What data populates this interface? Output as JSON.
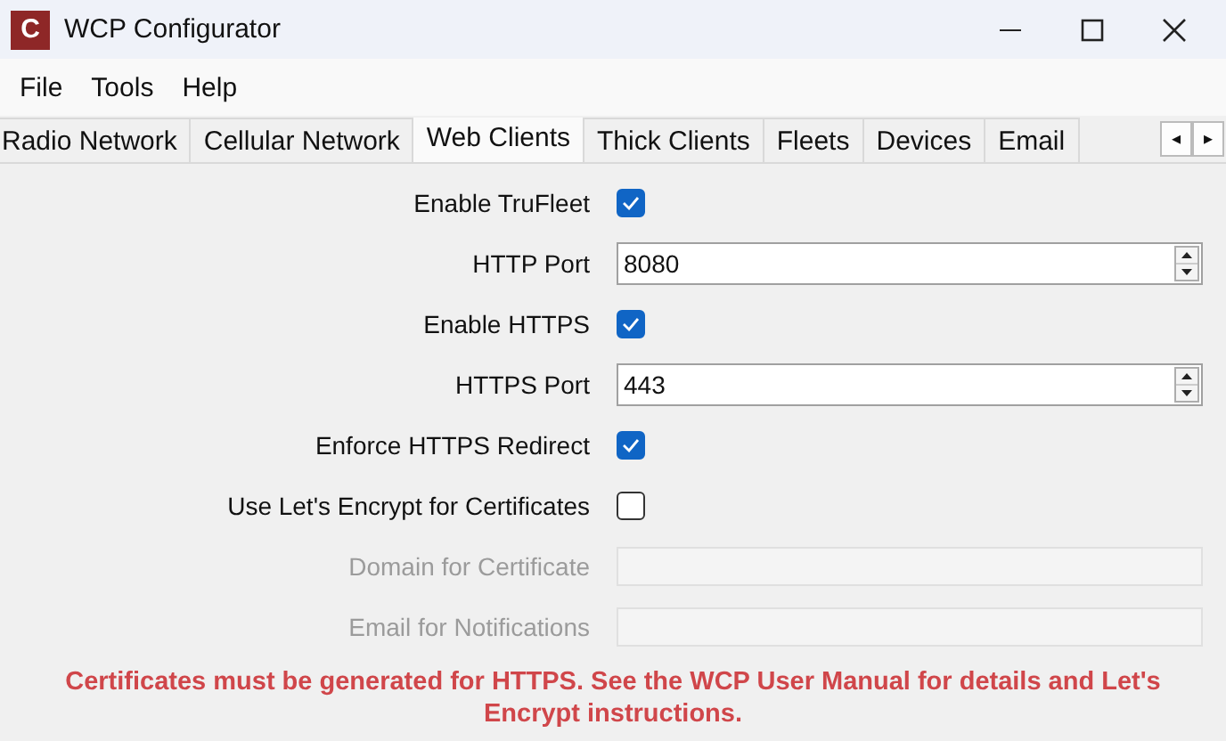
{
  "window": {
    "title": "WCP Configurator",
    "logo": "C"
  },
  "menu": [
    "File",
    "Tools",
    "Help"
  ],
  "tabs": [
    {
      "label": "Radio Network",
      "selected": false
    },
    {
      "label": "Cellular Network",
      "selected": false
    },
    {
      "label": "Web Clients",
      "selected": true
    },
    {
      "label": "Thick Clients",
      "selected": false
    },
    {
      "label": "Fleets",
      "selected": false
    },
    {
      "label": "Devices",
      "selected": false
    },
    {
      "label": "Email",
      "selected": false
    }
  ],
  "tab_scroll": [
    "◂",
    "▸"
  ],
  "form": [
    {
      "kind": "checkbox",
      "label": "Enable TruFleet",
      "checked": true,
      "disabled": false
    },
    {
      "kind": "spin",
      "label": "HTTP Port",
      "value": "8080",
      "disabled": false
    },
    {
      "kind": "checkbox",
      "label": "Enable HTTPS",
      "checked": true,
      "disabled": false
    },
    {
      "kind": "spin",
      "label": "HTTPS Port",
      "value": "443",
      "disabled": false
    },
    {
      "kind": "checkbox",
      "label": "Enforce HTTPS Redirect",
      "checked": true,
      "disabled": false
    },
    {
      "kind": "checkbox",
      "label": "Use Let's Encrypt for Certificates",
      "checked": false,
      "disabled": false
    },
    {
      "kind": "text",
      "label": "Domain for Certificate",
      "disabled": true
    },
    {
      "kind": "text",
      "label": "Email for Notifications",
      "disabled": true
    }
  ],
  "notice": "Certificates must be generated for HTTPS. See the WCP User Manual for details and Let's Encrypt instructions."
}
